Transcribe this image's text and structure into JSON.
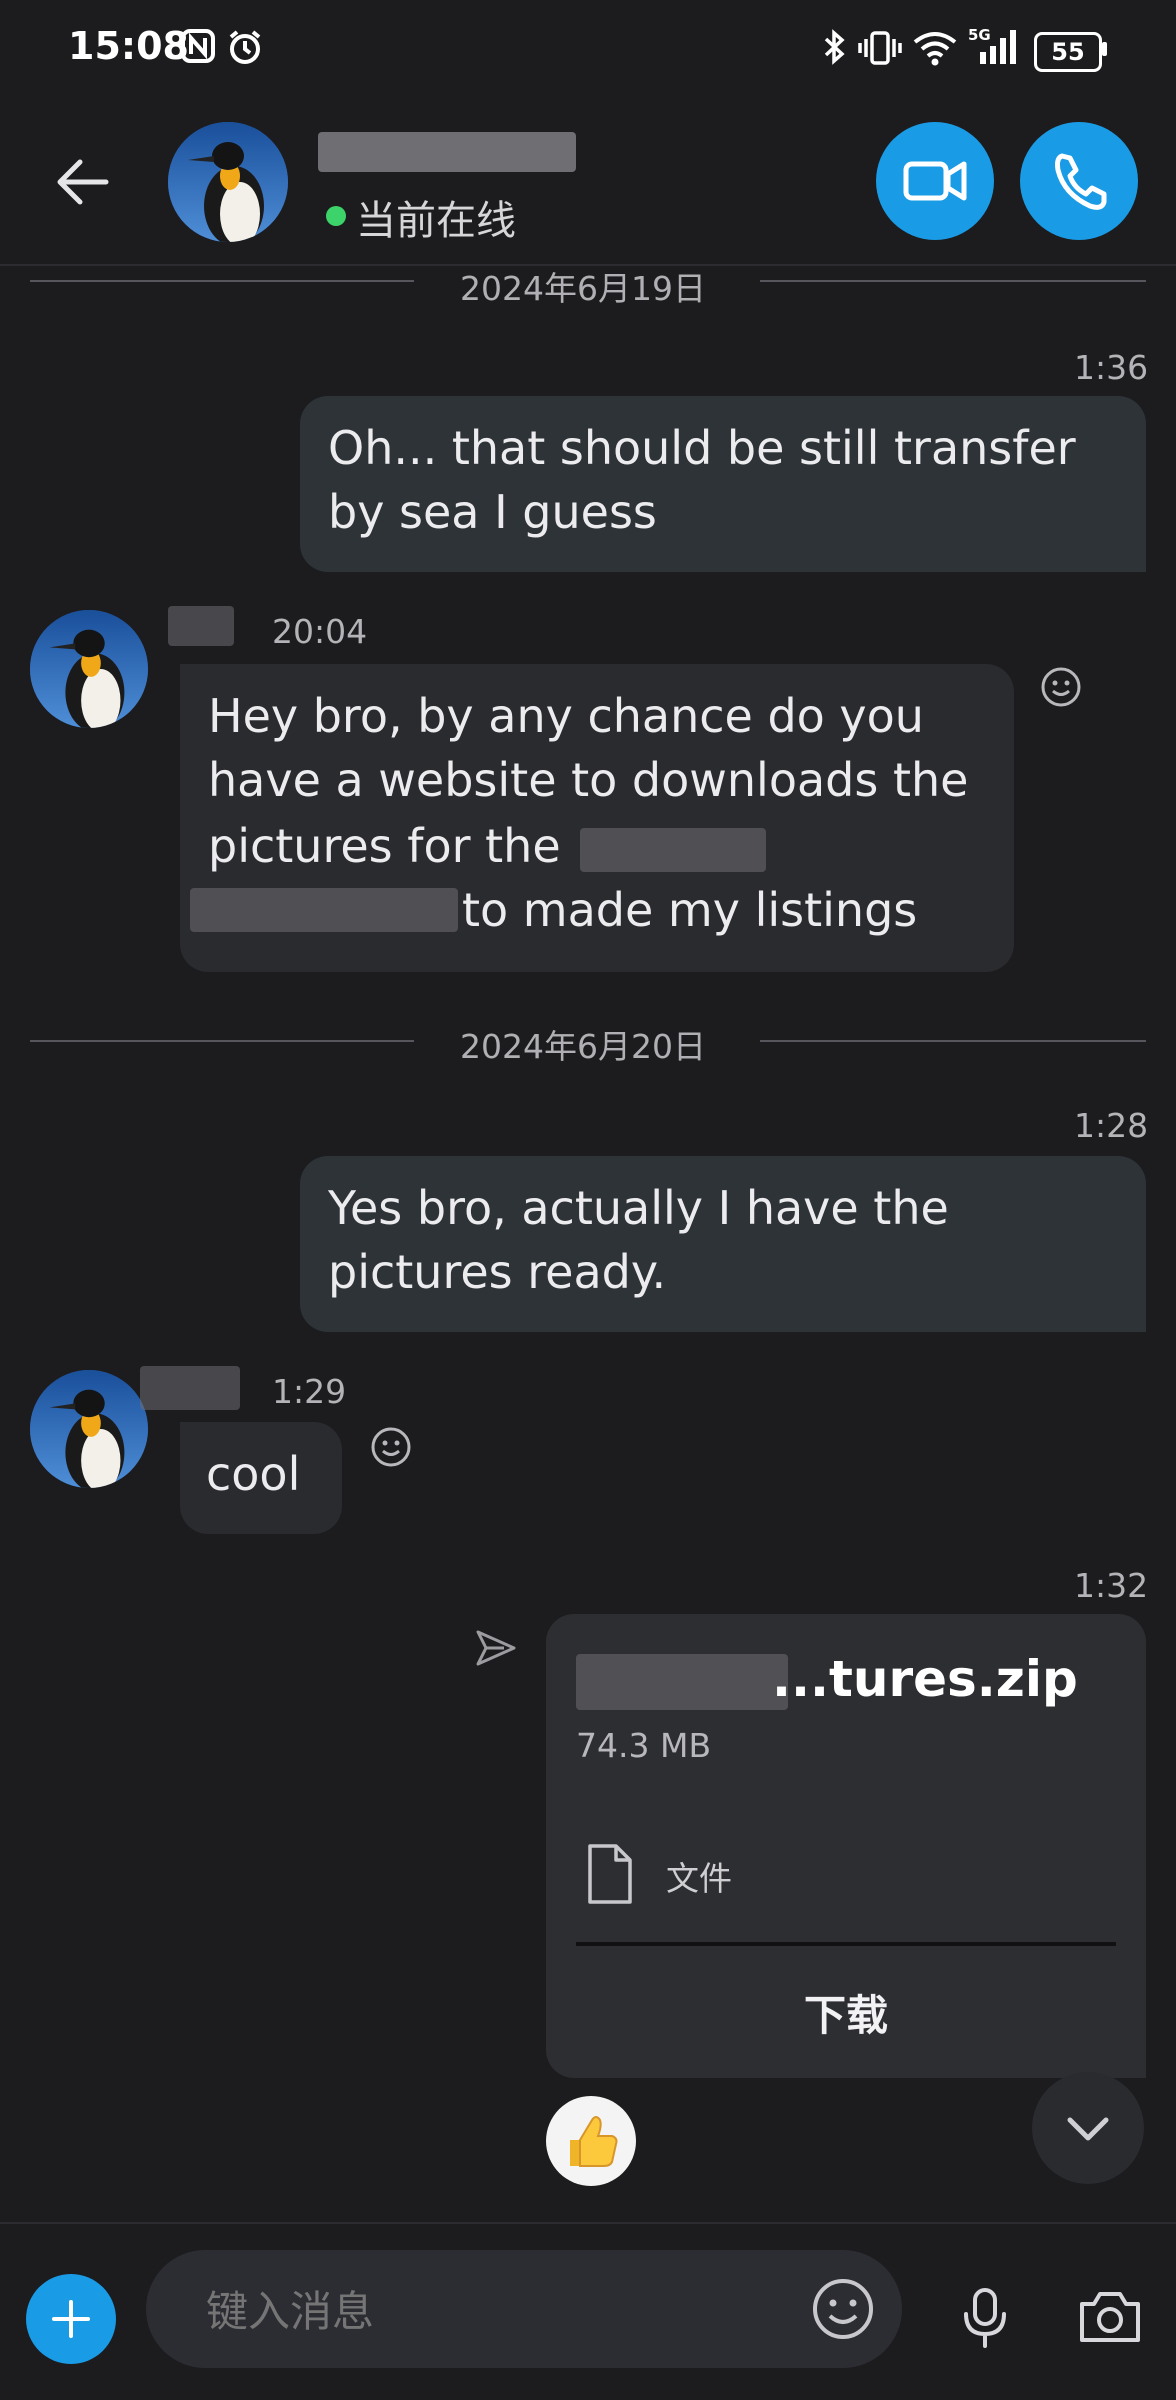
{
  "status_bar": {
    "time": "15:08",
    "battery": "55"
  },
  "header": {
    "presence": "当前在线"
  },
  "messages": {
    "date1": "2024年6月19日",
    "m1_time": "1:36",
    "m1_line1": "Oh... that should be still transfer",
    "m1_line2": "by sea I guess",
    "m2_time": "20:04",
    "m2_line1": "Hey bro, by any chance do you",
    "m2_line2": "have a website to downloads the",
    "m2_line3": "pictures for the",
    "m2_line4": "to made my listings",
    "date2": "2024年6月20日",
    "m3_time": "1:28",
    "m3_line1": "Yes bro, actually I have the",
    "m3_line2": "pictures ready.",
    "m4_time": "1:29",
    "m4_text": "cool",
    "m5_time": "1:32"
  },
  "file": {
    "name": "...tures.zip",
    "size": "74.3 MB",
    "type_label": "文件",
    "download_label": "下载"
  },
  "composer": {
    "placeholder": "键入消息"
  },
  "icons": {
    "back": "arrow-left-icon",
    "video": "video-camera-icon",
    "call": "phone-icon",
    "send_status": "paper-plane-icon",
    "reaction": "smiley-icon",
    "file": "document-icon",
    "like": "thumbs-up-icon",
    "add": "plus-icon",
    "emoji": "emoji-icon",
    "mic": "microphone-icon",
    "camera": "camera-icon",
    "scroll": "chevron-down-icon"
  },
  "colors": {
    "accent": "#1a9be6",
    "online": "#3cd36a",
    "background": "#1c1c1e"
  }
}
